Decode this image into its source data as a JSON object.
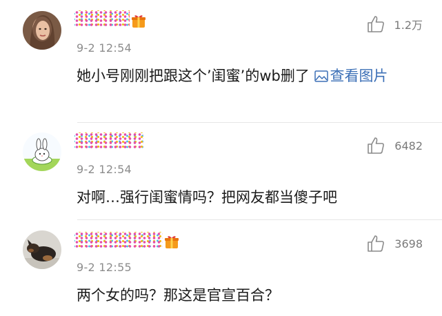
{
  "comments": [
    {
      "avatar": "woman-portrait-avatar",
      "time": "9-2 12:54",
      "text": "她小号刚刚把跟这个’闺蜜’的wb删了",
      "image_link_icon": "image-icon",
      "image_link_label": "查看图片",
      "likes": "1.2万",
      "vip": true
    },
    {
      "avatar": "cartoon-rabbit-avatar",
      "time": "9-2 12:54",
      "text": "对啊…强行闺蜜情吗？把网友都当傻子吧",
      "likes": "6482",
      "vip": false
    },
    {
      "avatar": "dog-avatar",
      "time": "9-2 12:55",
      "text": "两个女的吗？那这是官宣百合？",
      "likes": "3698",
      "vip": true
    }
  ],
  "colors": {
    "link": "#3b6fb6",
    "time": "#8c8c8c",
    "text": "#1a1a1a",
    "divider": "#e6e6e6"
  },
  "icons": [
    "thumbs-up-icon",
    "vip-gift-icon",
    "image-icon"
  ]
}
